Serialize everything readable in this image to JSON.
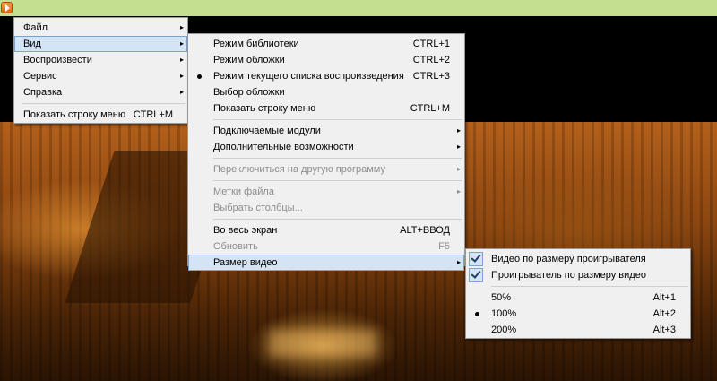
{
  "app_icon": "media-player-icon",
  "main_menu": {
    "items": [
      {
        "label": "Файл",
        "has_arrow": true
      },
      {
        "label": "Вид",
        "has_arrow": true
      },
      {
        "label": "Воспроизвести",
        "has_arrow": true
      },
      {
        "label": "Сервис",
        "has_arrow": true
      },
      {
        "label": "Справка",
        "has_arrow": true
      }
    ],
    "show_menu_bar": {
      "label": "Показать строку меню",
      "shortcut": "CTRL+M"
    }
  },
  "view_menu": {
    "library_mode": {
      "label": "Режим библиотеки",
      "shortcut": "CTRL+1"
    },
    "skin_mode": {
      "label": "Режим обложки",
      "shortcut": "CTRL+2"
    },
    "now_playing_mode": {
      "label": "Режим текущего списка воспроизведения",
      "shortcut": "CTRL+3"
    },
    "choose_skin": {
      "label": "Выбор обложки"
    },
    "show_menu_bar": {
      "label": "Показать строку меню",
      "shortcut": "CTRL+M"
    },
    "plugins": {
      "label": "Подключаемые модули"
    },
    "enhancements": {
      "label": "Дополнительные возможности"
    },
    "switch_program": {
      "label": "Переключиться на другую программу"
    },
    "file_markers": {
      "label": "Метки файла"
    },
    "choose_columns": {
      "label": "Выбрать столбцы..."
    },
    "fullscreen": {
      "label": "Во весь экран",
      "shortcut": "ALT+ВВОД"
    },
    "refresh": {
      "label": "Обновить",
      "shortcut": "F5"
    },
    "video_size": {
      "label": "Размер видео"
    }
  },
  "video_size_menu": {
    "fit_video_to_player": {
      "label": "Видео по размеру проигрывателя"
    },
    "fit_player_to_video": {
      "label": "Проигрыватель по размеру видео"
    },
    "size_50": {
      "label": "50%",
      "shortcut": "Alt+1"
    },
    "size_100": {
      "label": "100%",
      "shortcut": "Alt+2"
    },
    "size_200": {
      "label": "200%",
      "shortcut": "Alt+3"
    }
  },
  "arrow_glyph": "▸",
  "colors": {
    "title_bar": "#c3df8f",
    "menu_bg": "#f0f0f0",
    "highlight": "#d5e4f4",
    "highlight_border": "#7da2ce"
  }
}
